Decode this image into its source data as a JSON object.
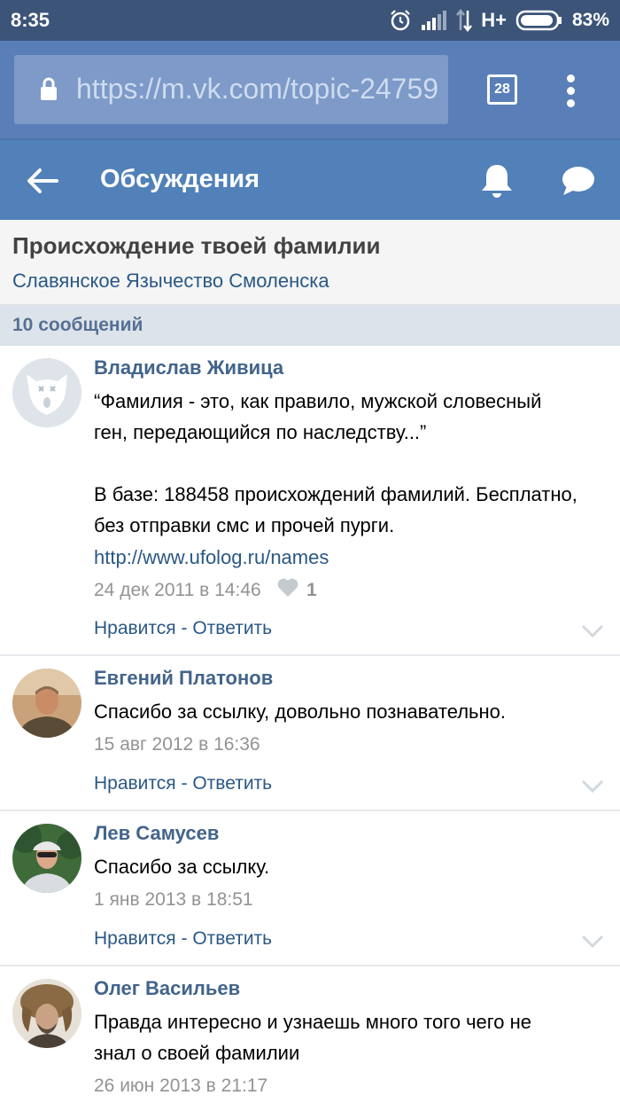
{
  "status_bar": {
    "time": "8:35",
    "network": "H+",
    "battery": "83%",
    "icons": [
      "alarm-icon",
      "signal-icon",
      "network-arrows-icon",
      "battery-icon"
    ]
  },
  "browser": {
    "url": "https://m.vk.com/topic-24759",
    "tab_count": "28",
    "icons": [
      "lock-icon",
      "tabs-icon",
      "more-vertical-icon"
    ]
  },
  "app_header": {
    "title": "Обсуждения",
    "icons": [
      "back-arrow-icon",
      "bell-icon",
      "chat-bubble-icon"
    ]
  },
  "topic": {
    "title": "Происхождение твоей фамилии",
    "group": "Славянское Язычество Смоленска"
  },
  "message_count": "10 сообщений",
  "posts": [
    {
      "author": "Владислав Живица",
      "text": "“Фамилия - это, как правило, мужской словесный\nген, передающийся по наследству...”\n\nВ базе: 188458 происхождений фамилий. Бесплатно,\nбез отправки смс и прочей пурги.",
      "link": "http://www.ufolog.ru/names",
      "date": "24 дек 2011 в 14:46",
      "likes": "1",
      "like_label": "Нравится",
      "separator": " - ",
      "reply_label": "Ответить"
    },
    {
      "author": "Евгений Платонов",
      "text": "Спасибо за ссылку, довольно познавательно.",
      "date": "15 авг 2012 в 16:36",
      "like_label": "Нравится",
      "separator": " - ",
      "reply_label": "Ответить"
    },
    {
      "author": "Лев Самусев",
      "text": "Спасибо за ссылку.",
      "date": "1 янв 2013 в 18:51",
      "like_label": "Нравится",
      "separator": " - ",
      "reply_label": "Ответить"
    },
    {
      "author": "Олег Васильев",
      "text": "Правда интересно и узнаешь много того чего не\nзнал о своей фамилии",
      "date": "26 июн 2013 в 21:17"
    }
  ],
  "colors": {
    "status_bar": "#3c5478",
    "browser_bar": "#5a7fb8",
    "app_header": "#5181b8",
    "link": "#2a5885",
    "author": "#42648b"
  }
}
